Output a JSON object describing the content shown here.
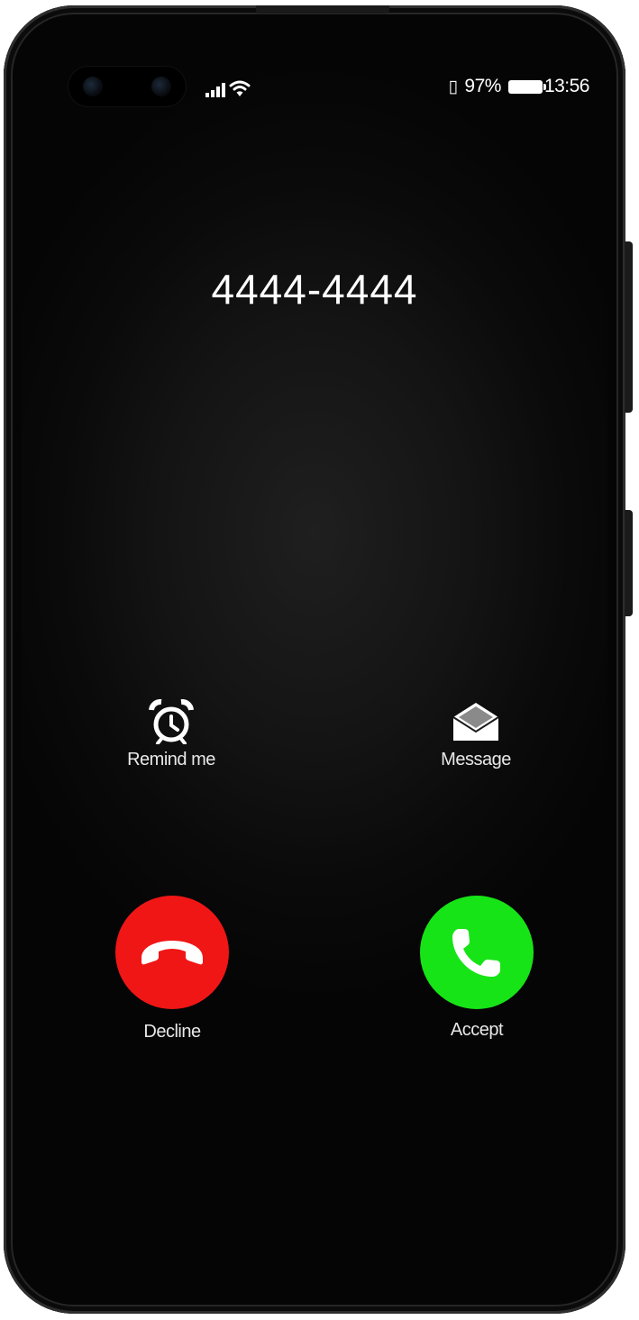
{
  "status_bar": {
    "battery_percent": "97%",
    "time": "13:56",
    "vibrate_glyph": "▯"
  },
  "call": {
    "caller": "4444-4444"
  },
  "actions": {
    "remind_label": "Remind me",
    "message_label": "Message",
    "decline_label": "Decline",
    "accept_label": "Accept"
  },
  "colors": {
    "decline": "#f01616",
    "accept": "#17e417"
  },
  "icons": {
    "remind": "alarm-clock-icon",
    "message": "open-envelope-icon",
    "decline": "phone-hangup-icon",
    "accept": "phone-icon",
    "signal": "signal-bars-icon",
    "wifi": "wifi-icon",
    "battery": "battery-icon"
  }
}
